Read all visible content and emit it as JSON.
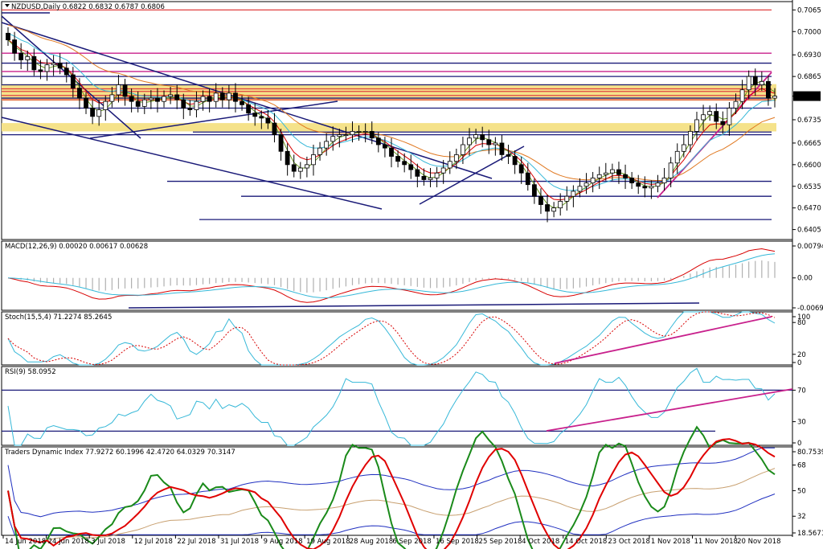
{
  "chart_data": [
    {
      "type": "candlestick",
      "title": "NZDUSD,Daily 0.6822 0.6832 0.6787 0.6806",
      "symbol": "NZDUSD",
      "timeframe": "Daily",
      "ohlc_header": {
        "open": 0.6822,
        "high": 0.6832,
        "low": 0.6787,
        "close": 0.6806
      },
      "last_price_label": "0.6806",
      "ylim": [
        0.6375,
        0.709
      ],
      "y_ticks": [
        "0.7065",
        "0.7000",
        "0.6930",
        "0.6865",
        "0.6806",
        "0.6735",
        "0.6665",
        "0.6600",
        "0.6535",
        "0.6470",
        "0.6405"
      ],
      "x_labels": [
        "14 Jun 2018",
        "24 Jun 2018",
        "3 Jul 2018",
        "12 Jul 2018",
        "22 Jul 2018",
        "31 Jul 2018",
        "9 Aug 2018",
        "19 Aug 2018",
        "28 Aug 2018",
        "6 Sep 2018",
        "16 Sep 2018",
        "25 Sep 2018",
        "4 Oct 2018",
        "14 Oct 2018",
        "23 Oct 2018",
        "1 Nov 2018",
        "11 Nov 2018",
        "20 Nov 2018"
      ],
      "closes": [
        0.6975,
        0.6935,
        0.6915,
        0.6925,
        0.6885,
        0.688,
        0.69,
        0.6905,
        0.689,
        0.687,
        0.683,
        0.68,
        0.677,
        0.6745,
        0.6765,
        0.679,
        0.681,
        0.684,
        0.6805,
        0.679,
        0.6775,
        0.6795,
        0.68,
        0.679,
        0.6805,
        0.681,
        0.6795,
        0.677,
        0.6765,
        0.679,
        0.6805,
        0.679,
        0.6815,
        0.6795,
        0.6815,
        0.679,
        0.678,
        0.6755,
        0.6745,
        0.674,
        0.6725,
        0.669,
        0.664,
        0.66,
        0.658,
        0.659,
        0.66,
        0.663,
        0.665,
        0.667,
        0.6685,
        0.669,
        0.669,
        0.67,
        0.67,
        0.67,
        0.668,
        0.666,
        0.665,
        0.6625,
        0.661,
        0.66,
        0.6585,
        0.6565,
        0.6555,
        0.656,
        0.6575,
        0.659,
        0.661,
        0.663,
        0.666,
        0.668,
        0.669,
        0.6675,
        0.666,
        0.6665,
        0.663,
        0.6625,
        0.66,
        0.6575,
        0.654,
        0.6505,
        0.648,
        0.646,
        0.647,
        0.649,
        0.6505,
        0.652,
        0.6535,
        0.6545,
        0.656,
        0.657,
        0.6575,
        0.6585,
        0.657,
        0.656,
        0.6545,
        0.6535,
        0.653,
        0.6535,
        0.6545,
        0.656,
        0.6605,
        0.664,
        0.666,
        0.67,
        0.6735,
        0.675,
        0.676,
        0.673,
        0.672,
        0.677,
        0.679,
        0.6825,
        0.6865,
        0.684,
        0.685,
        0.68,
        0.6806
      ],
      "price_range_ends": {
        "start": "14 Jun 2018",
        "end": "20 Nov 2018"
      },
      "horizontal_levels": [
        0.7065,
        0.6935,
        0.6905,
        0.688,
        0.6865,
        0.684,
        0.6828,
        0.682,
        0.6808,
        0.68,
        0.6795,
        0.677,
        0.6698,
        0.669,
        0.655,
        0.6505,
        0.6435
      ],
      "support_resistance_zones": [
        [
          0.6792,
          0.6842
        ],
        [
          0.67,
          0.6725
        ]
      ]
    },
    {
      "type": "line",
      "title": "MACD(12,26,9) 0.00020 0.00617 0.00628",
      "y_ticks": [
        "0.00794",
        "0.00",
        "-0.00699"
      ],
      "ylim": [
        -0.00699,
        0.00794
      ]
    },
    {
      "type": "line",
      "title": "Stoch(15,5,4) 71.2274 85.2645",
      "y_ticks": [
        "100",
        "80",
        "20",
        "0"
      ],
      "ylim": [
        0,
        100
      ]
    },
    {
      "type": "line",
      "title": "RSI(9) 58.0952",
      "y_ticks": [
        "70",
        "30",
        "0"
      ],
      "ylim": [
        0,
        100
      ]
    },
    {
      "type": "line",
      "title": "Traders Dynamic Index 77.9272 60.1996 42.4720 64.0329 70.3147",
      "y_ticks": [
        "80.7539",
        "68",
        "50",
        "32",
        "18.5671"
      ],
      "ylim": [
        18.5671,
        80.7539
      ]
    }
  ],
  "colors": {
    "ma_fast": "#d80000",
    "ma_mid": "#6a9a1e",
    "ma_slow_cyan": "#36b8d8",
    "ma_slow_orange": "#e07820",
    "trendline": "#1a1a78",
    "trendline_magenta": "#c8208c",
    "zone": "#f5e28a",
    "level_red": "#e04040",
    "level_navy": "#1a1a78",
    "tdi_blue": "#2030c0",
    "tdi_green": "#1a8a1a",
    "tdi_red": "#e00000",
    "tdi_tan": "#c8a070",
    "price_box_bg": "#000000"
  }
}
